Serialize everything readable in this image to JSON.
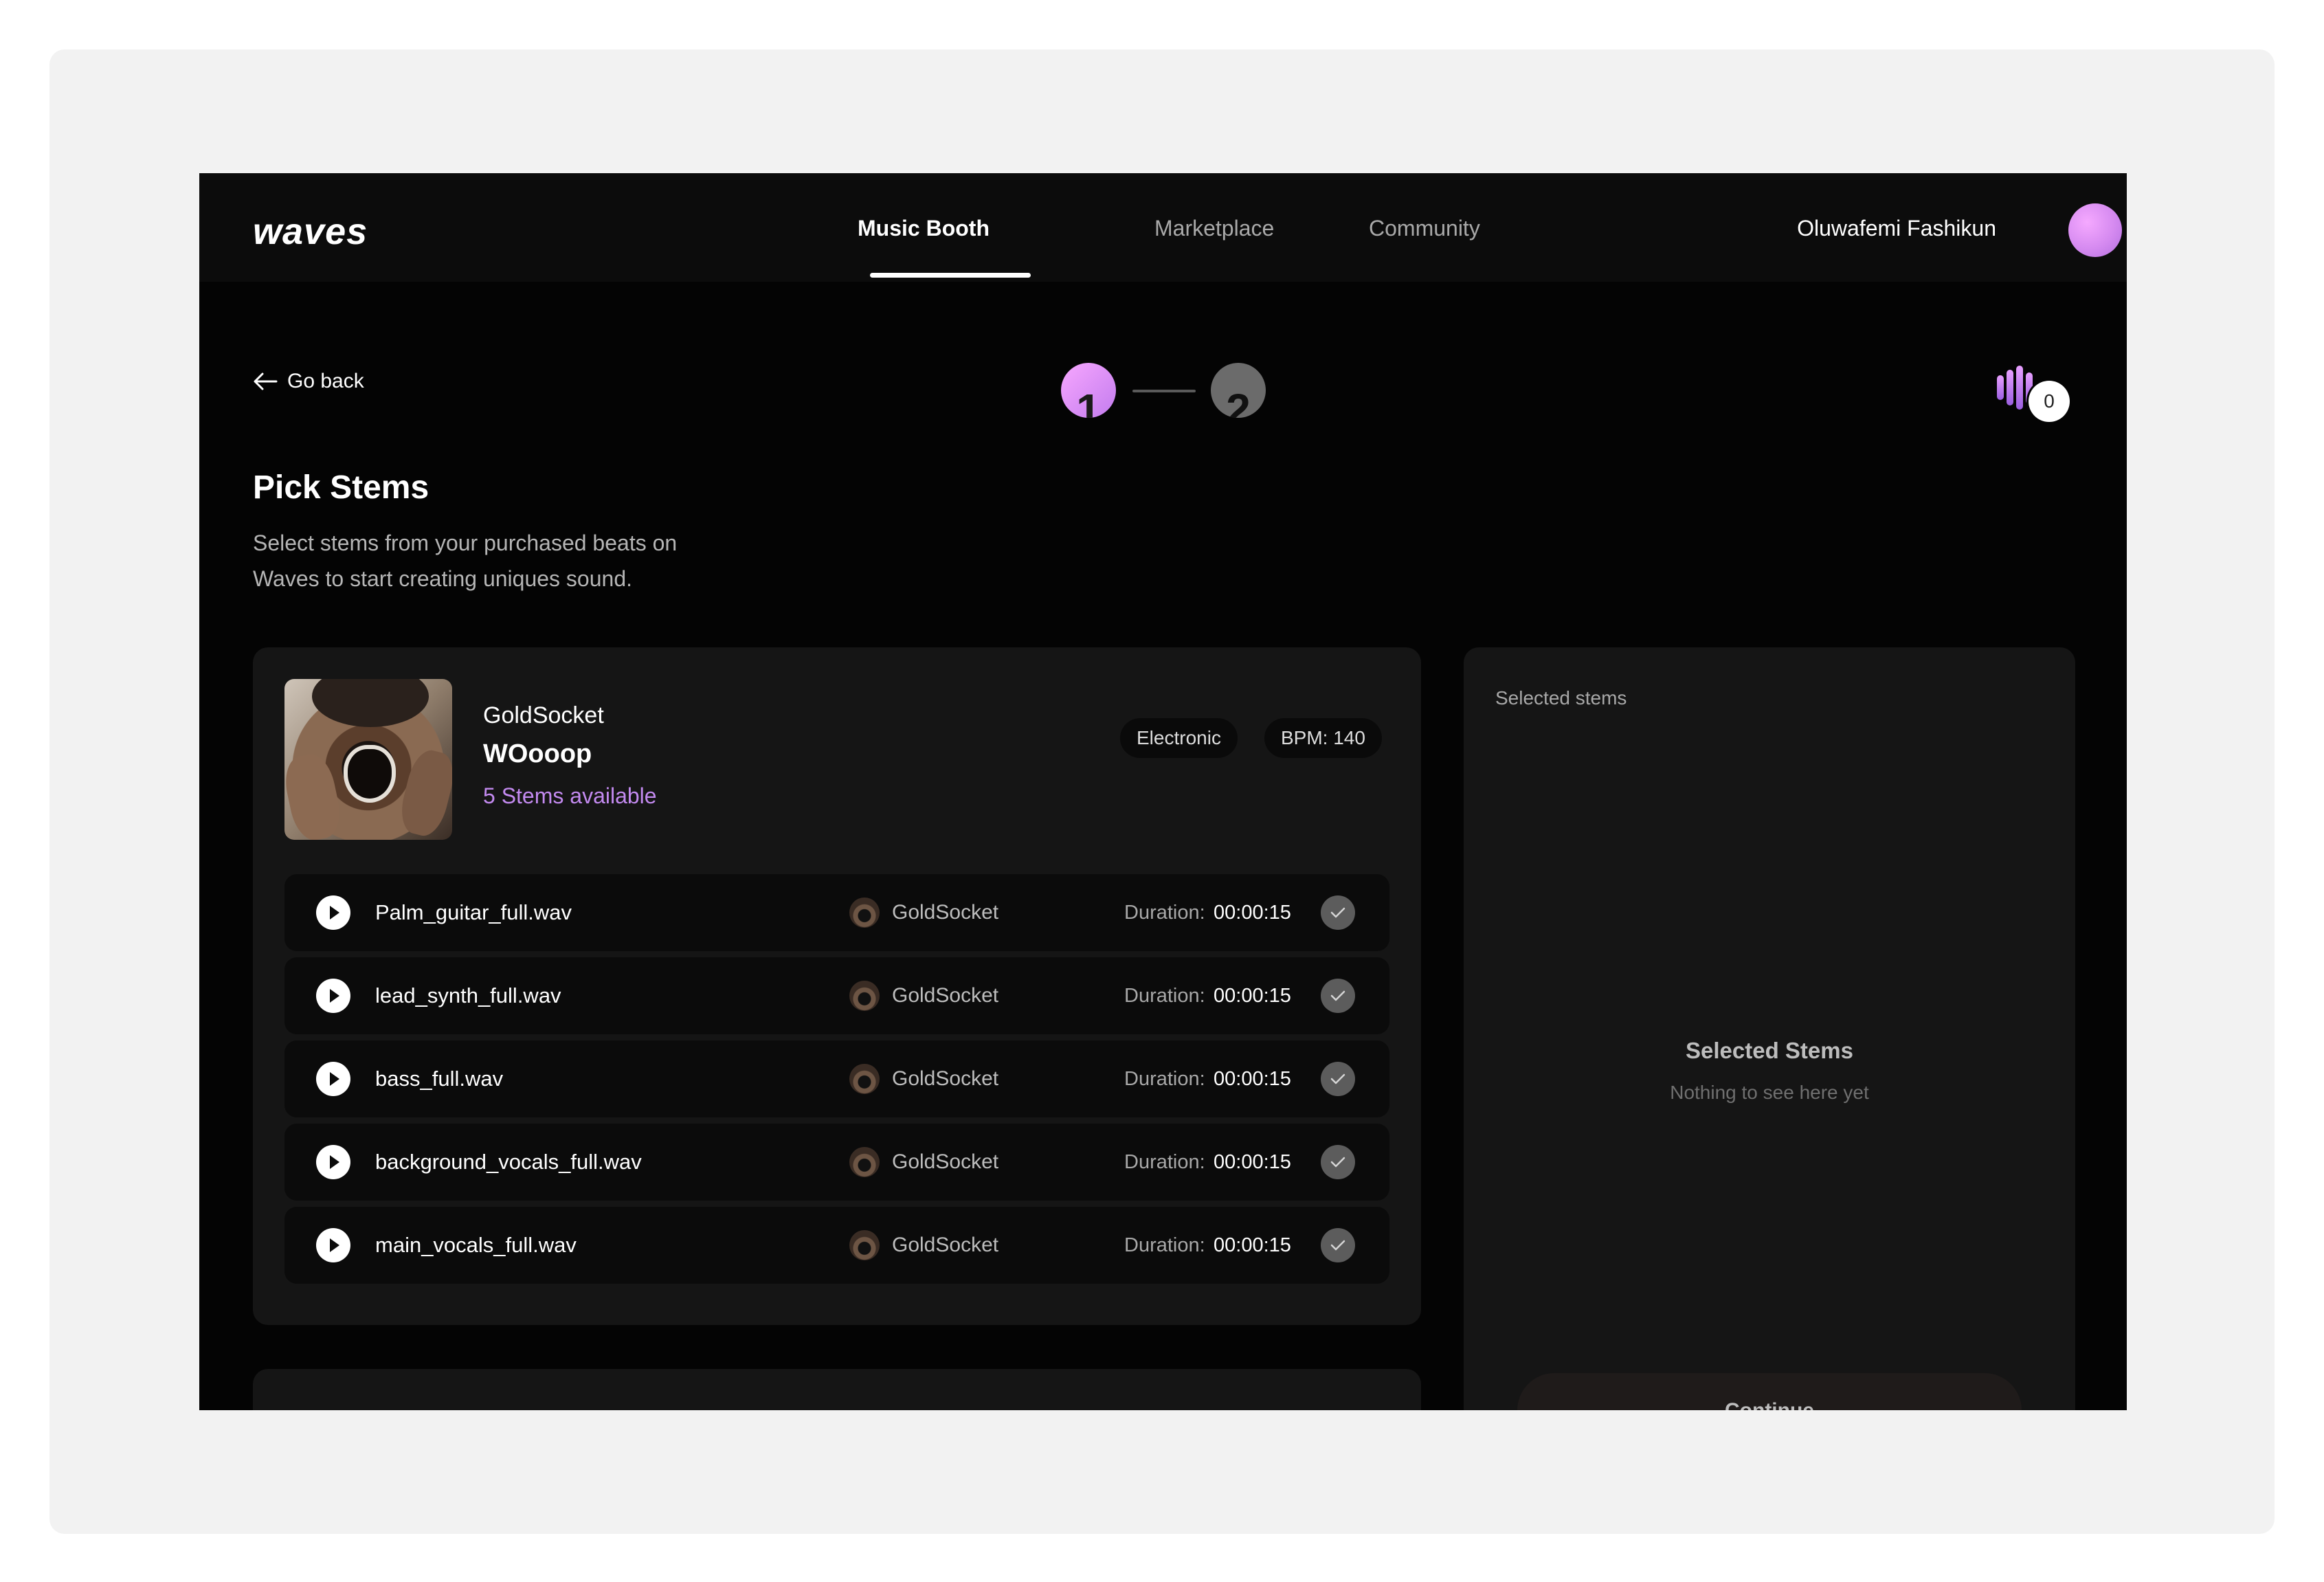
{
  "nav": {
    "logo": "waves",
    "links": [
      {
        "label": "Music Booth",
        "active": true
      },
      {
        "label": "Marketplace",
        "active": false
      },
      {
        "label": "Community",
        "active": false
      }
    ],
    "user_name": "Oluwafemi Fashikun",
    "avatar_icon": "avatar-gradient"
  },
  "header": {
    "go_back": "Go back",
    "go_back_icon": "arrow-left-icon",
    "steps": [
      "1",
      "2"
    ],
    "active_step": 1,
    "cart_icon": "sound-bars-icon",
    "cart_count": "0"
  },
  "page": {
    "title": "Pick Stems",
    "subtitle": "Select stems from your purchased beats on Waves to start creating uniques sound."
  },
  "beat": {
    "artist": "GoldSocket",
    "title": "WOooop",
    "stems_available": "5 Stems available",
    "tags": [
      "Electronic",
      "BPM: 140"
    ],
    "stems": [
      {
        "name": "Palm_guitar_full.wav",
        "owner": "GoldSocket",
        "duration_label": "Duration:",
        "duration": "00:00:15"
      },
      {
        "name": "lead_synth_full.wav",
        "owner": "GoldSocket",
        "duration_label": "Duration:",
        "duration": "00:00:15"
      },
      {
        "name": "bass_full.wav",
        "owner": "GoldSocket",
        "duration_label": "Duration:",
        "duration": "00:00:15"
      },
      {
        "name": "background_vocals_full.wav",
        "owner": "GoldSocket",
        "duration_label": "Duration:",
        "duration": "00:00:15"
      },
      {
        "name": "main_vocals_full.wav",
        "owner": "GoldSocket",
        "duration_label": "Duration:",
        "duration": "00:00:15"
      }
    ]
  },
  "selected": {
    "label": "Selected stems",
    "empty_title": "Selected Stems",
    "empty_subtitle": "Nothing to see here yet",
    "continue": "Continue"
  },
  "colors": {
    "background": "#040404",
    "card": "#151515",
    "accent": "#c38af0",
    "text": "#ffffff"
  }
}
